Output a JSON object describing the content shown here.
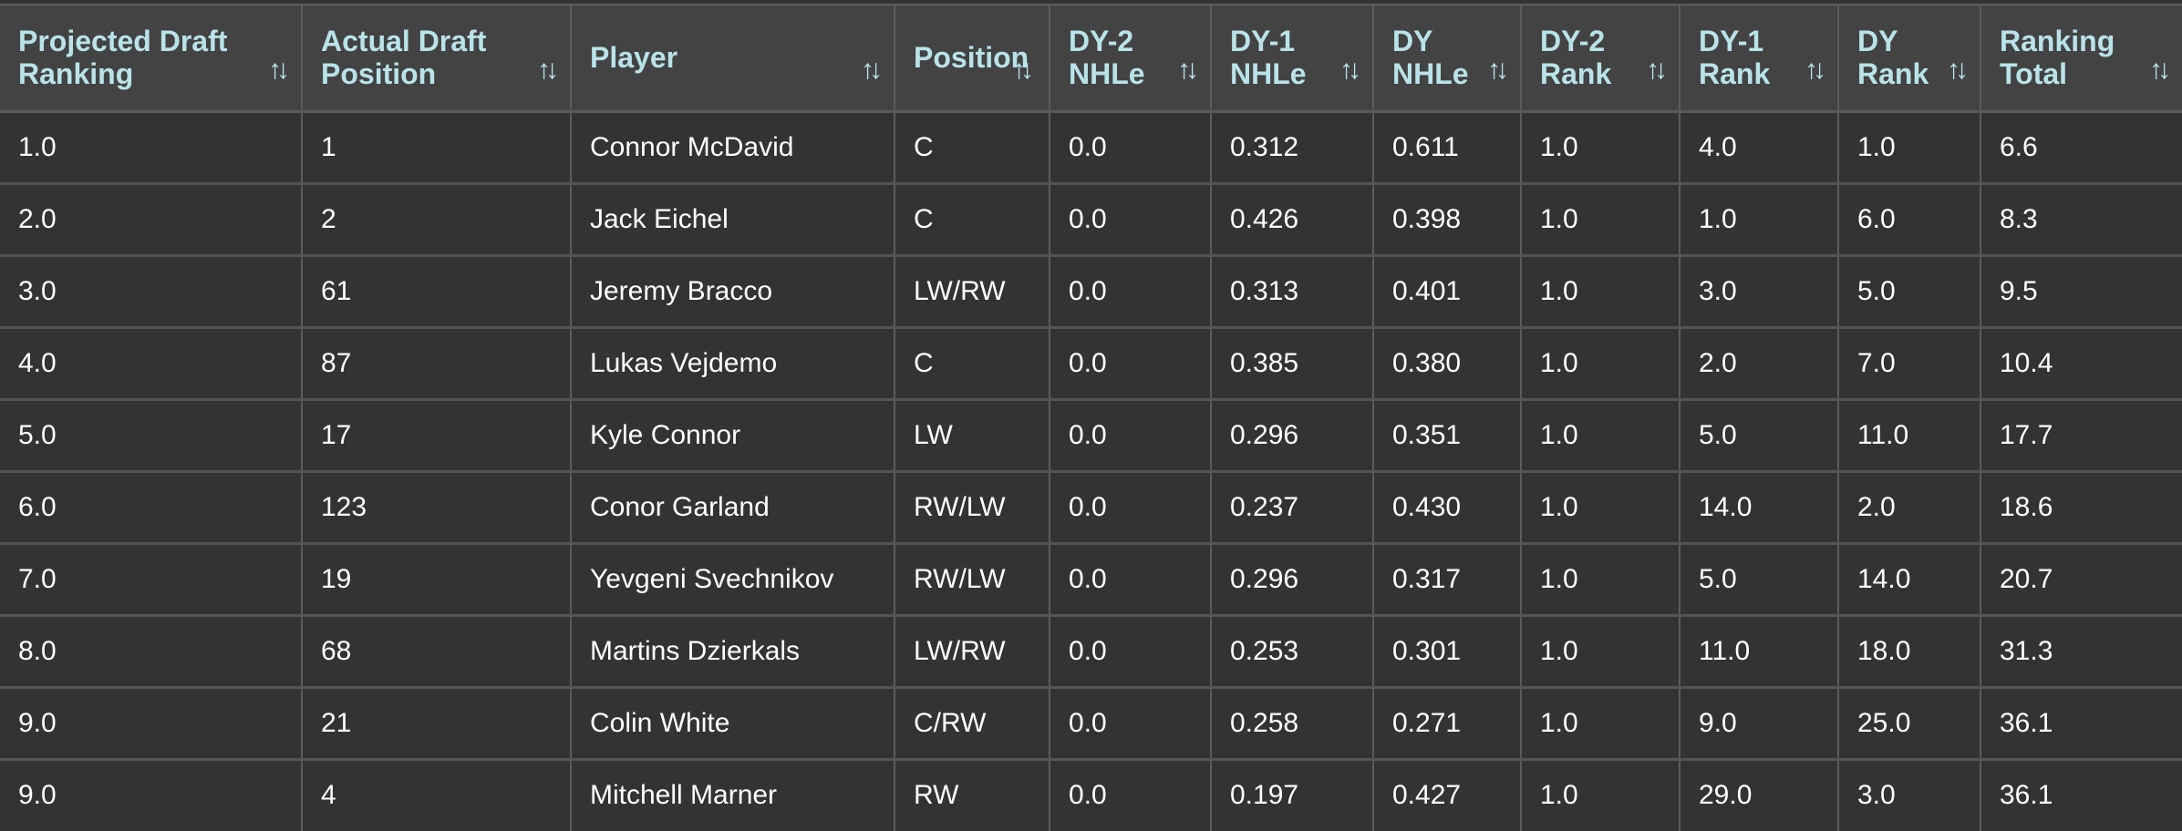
{
  "table": {
    "columns": [
      {
        "label_line1": "Projected Draft",
        "label_line2": "Ranking",
        "sort_icon": "⇅"
      },
      {
        "label_line1": "Actual Draft",
        "label_line2": "Position",
        "sort_icon": "⇅"
      },
      {
        "label_line1": "Player",
        "label_line2": "",
        "sort_icon": "⇅"
      },
      {
        "label_line1": "Position",
        "label_line2": "",
        "sort_icon": "⇅"
      },
      {
        "label_line1": "DY-2",
        "label_line2": "NHLe",
        "sort_icon": "⇅"
      },
      {
        "label_line1": "DY-1",
        "label_line2": "NHLe",
        "sort_icon": "⇅"
      },
      {
        "label_line1": "DY",
        "label_line2": "NHLe",
        "sort_icon": "⇅"
      },
      {
        "label_line1": "DY-2",
        "label_line2": "Rank",
        "sort_icon": "⇅"
      },
      {
        "label_line1": "DY-1",
        "label_line2": "Rank",
        "sort_icon": "⇅"
      },
      {
        "label_line1": "DY",
        "label_line2": "Rank",
        "sort_icon": "⇅"
      },
      {
        "label_line1": "Ranking",
        "label_line2": "Total",
        "sort_icon": "⇅"
      }
    ],
    "rows": [
      [
        "1.0",
        "1",
        "Connor McDavid",
        "C",
        "0.0",
        "0.312",
        "0.611",
        "1.0",
        "4.0",
        "1.0",
        "6.6"
      ],
      [
        "2.0",
        "2",
        "Jack Eichel",
        "C",
        "0.0",
        "0.426",
        "0.398",
        "1.0",
        "1.0",
        "6.0",
        "8.3"
      ],
      [
        "3.0",
        "61",
        "Jeremy Bracco",
        "LW/RW",
        "0.0",
        "0.313",
        "0.401",
        "1.0",
        "3.0",
        "5.0",
        "9.5"
      ],
      [
        "4.0",
        "87",
        "Lukas Vejdemo",
        "C",
        "0.0",
        "0.385",
        "0.380",
        "1.0",
        "2.0",
        "7.0",
        "10.4"
      ],
      [
        "5.0",
        "17",
        "Kyle Connor",
        "LW",
        "0.0",
        "0.296",
        "0.351",
        "1.0",
        "5.0",
        "11.0",
        "17.7"
      ],
      [
        "6.0",
        "123",
        "Conor Garland",
        "RW/LW",
        "0.0",
        "0.237",
        "0.430",
        "1.0",
        "14.0",
        "2.0",
        "18.6"
      ],
      [
        "7.0",
        "19",
        "Yevgeni Svechnikov",
        "RW/LW",
        "0.0",
        "0.296",
        "0.317",
        "1.0",
        "5.0",
        "14.0",
        "20.7"
      ],
      [
        "8.0",
        "68",
        "Martins Dzierkals",
        "LW/RW",
        "0.0",
        "0.253",
        "0.301",
        "1.0",
        "11.0",
        "18.0",
        "31.3"
      ],
      [
        "9.0",
        "21",
        "Colin White",
        "C/RW",
        "0.0",
        "0.258",
        "0.271",
        "1.0",
        "9.0",
        "25.0",
        "36.1"
      ],
      [
        "9.0",
        "4",
        "Mitchell Marner",
        "RW",
        "0.0",
        "0.197",
        "0.427",
        "1.0",
        "29.0",
        "3.0",
        "36.1"
      ]
    ]
  },
  "colors": {
    "header_bg": "#434343",
    "header_text": "#b9e3e9",
    "body_bg": "#333333",
    "body_text": "#ffffff"
  }
}
